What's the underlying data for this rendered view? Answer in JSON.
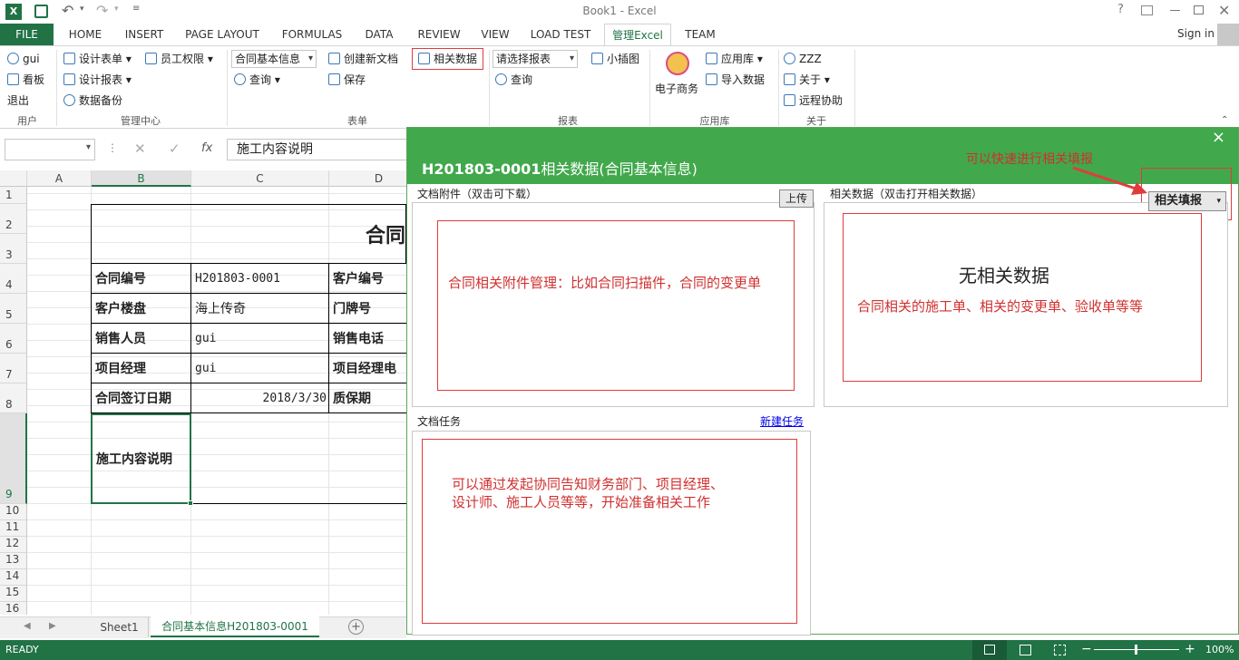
{
  "window": {
    "title": "Book1 - Excel",
    "sign_in": "Sign in"
  },
  "tabs": [
    {
      "label": "FILE"
    },
    {
      "label": "HOME"
    },
    {
      "label": "INSERT"
    },
    {
      "label": "PAGE LAYOUT"
    },
    {
      "label": "FORMULAS"
    },
    {
      "label": "DATA"
    },
    {
      "label": "REVIEW"
    },
    {
      "label": "VIEW"
    },
    {
      "label": "LOAD TEST"
    },
    {
      "label": "管理Excel"
    },
    {
      "label": "TEAM"
    }
  ],
  "ribbon": {
    "user_group": {
      "name": "用户",
      "user": "gui",
      "kanban": "看板",
      "logout": "退出"
    },
    "manage_group": {
      "name": "管理中心",
      "design_form": "设计表单",
      "design_report": "设计报表",
      "backup": "数据备份",
      "permissions": "员工权限"
    },
    "form_group": {
      "name": "表单",
      "form_select": "合同基本信息",
      "query": "查询",
      "new_doc": "创建新文档",
      "save": "保存",
      "related": "相关数据"
    },
    "report_group": {
      "name": "报表",
      "report_select": "请选择报表",
      "query": "查询",
      "chart": "小插图"
    },
    "app_group": {
      "name": "应用库",
      "ecommerce": "电子商务",
      "app_store": "应用库",
      "import": "导入数据"
    },
    "about_group": {
      "name": "关于",
      "zzz": "ZZZ",
      "about": "关于",
      "remote": "远程协助"
    }
  },
  "formula_bar": {
    "fx": "fx",
    "content": "施工内容说明"
  },
  "sheet": {
    "columns": [
      "A",
      "B",
      "C",
      "D"
    ],
    "rows": [
      "1",
      "2",
      "3",
      "4",
      "5",
      "6",
      "7",
      "8",
      "9",
      "10",
      "11",
      "12",
      "13",
      "14",
      "15",
      "16"
    ],
    "title": "合同",
    "labels": {
      "contract_no": "合同编号",
      "customer_no": "客户编号",
      "property": "客户楼盘",
      "door_no": "门牌号",
      "sales": "销售人员",
      "sales_phone": "销售电话",
      "pm": "项目经理",
      "pm_phone": "项目经理电",
      "sign_date": "合同签订日期",
      "warranty": "质保期",
      "content": "施工内容说明"
    },
    "values": {
      "contract_no": "H201803-0001",
      "property": "海上传奇",
      "sales": "gui",
      "pm": "gui",
      "sign_date": "2018/3/30"
    }
  },
  "sheet_tabs": {
    "sheet1": "Sheet1",
    "active": "合同基本信息H201803-0001"
  },
  "status": {
    "ready": "READY",
    "zoom": "100%"
  },
  "dialog": {
    "close": "×",
    "id": "H201803-0001",
    "title_rest": "相关数据(合同基本信息)",
    "attachments_legend": "文档附件（双击可下载）",
    "upload": "上传",
    "related_legend": "相关数据（双击打开相关数据）",
    "related_fill": "相关填报",
    "no_data": "无相关数据",
    "tasks_legend": "文档任务",
    "new_task": "新建任务",
    "annot_quick": "可以快速进行相关填报",
    "annot_attach": "合同相关附件管理：比如合同扫描件，合同的变更单",
    "annot_related": "合同相关的施工单、相关的变更单、验收单等等",
    "annot_tasks_1": "可以通过发起协同告知财务部门、项目经理、",
    "annot_tasks_2": "设计师、施工人员等等，开始准备相关工作"
  },
  "colors": {
    "excel_green": "#217346",
    "dialog_green": "#41a84c",
    "annotation_red": "#d03030"
  }
}
